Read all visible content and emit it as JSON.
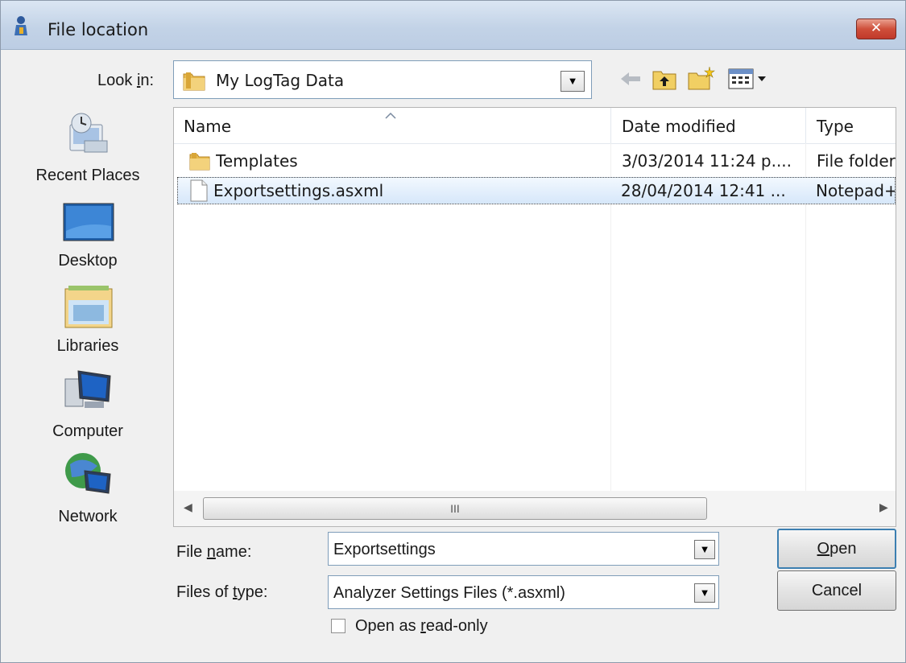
{
  "window": {
    "title": "File location",
    "close_label": "✕"
  },
  "lookin": {
    "label": "Look in:",
    "value": "My LogTag Data"
  },
  "places": [
    {
      "label": "Recent Places",
      "icon": "recent-places-icon"
    },
    {
      "label": "Desktop",
      "icon": "desktop-icon"
    },
    {
      "label": "Libraries",
      "icon": "libraries-icon"
    },
    {
      "label": "Computer",
      "icon": "computer-icon"
    },
    {
      "label": "Network",
      "icon": "network-icon"
    }
  ],
  "columns": {
    "name": "Name",
    "date": "Date modified",
    "type": "Type"
  },
  "files": [
    {
      "name": "Templates",
      "date": "3/03/2014 11:24 p....",
      "type": "File folder",
      "icon": "folder-icon"
    },
    {
      "name": "Exportsettings.asxml",
      "date": "28/04/2014 12:41 ...",
      "type": "Notepad+",
      "icon": "file-icon"
    }
  ],
  "scroll": {
    "thumb_label": "III"
  },
  "form": {
    "filename_label_pre": "File ",
    "filename_label_u": "n",
    "filename_label_post": "ame:",
    "filename_value": "Exportsettings",
    "filetype_label_pre": "Files of ",
    "filetype_label_u": "t",
    "filetype_label_post": "ype:",
    "filetype_value": "Analyzer Settings Files (*.asxml)",
    "readonly_pre": "Open as ",
    "readonly_u": "r",
    "readonly_post": "ead-only",
    "open_u": "O",
    "open_rest": "pen",
    "cancel": "Cancel"
  },
  "colors": {
    "title_gradient_top": "#dbe6f3",
    "selection": "#d6e7fa",
    "close_red": "#c0392b"
  }
}
